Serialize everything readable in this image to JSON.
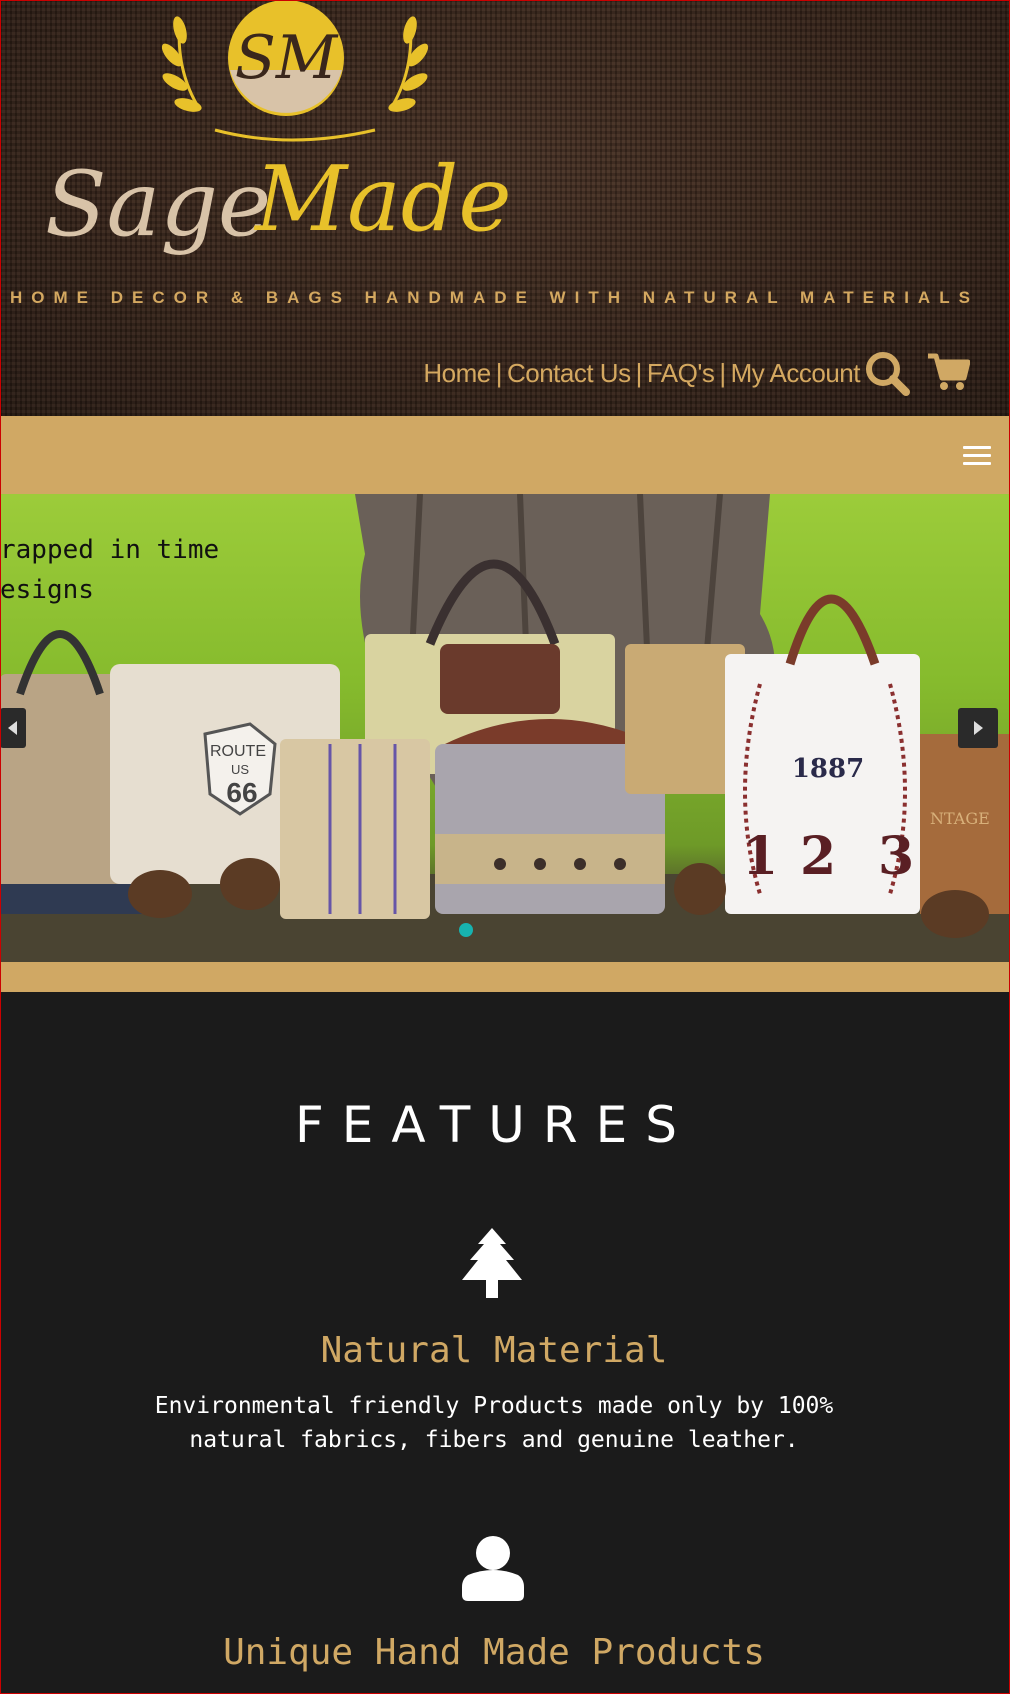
{
  "brand": {
    "logo_monogram": "SM",
    "logo_wordmark": "SageMade",
    "tagline": "HOME DECOR & BAGS HANDMADE WITH NATURAL MATERIALS"
  },
  "top_nav": {
    "items": [
      {
        "label": "Home"
      },
      {
        "label": "Contact Us"
      },
      {
        "label": "FAQ's"
      },
      {
        "label": "My Account"
      }
    ],
    "separator": "|",
    "icons": [
      "search-icon",
      "cart-icon"
    ]
  },
  "menu": {
    "icon": "hamburger-icon"
  },
  "slider": {
    "caption_line1": "rapped in time",
    "caption_line2": "esigns",
    "image_labels": {
      "route": "ROUTE",
      "us": "US",
      "route_number": "66",
      "year": "1887",
      "numbers": [
        "1",
        "2",
        "3"
      ],
      "vintage": "NTAGE"
    },
    "active_slide": 1
  },
  "features": {
    "heading": "FEATURES",
    "items": [
      {
        "icon": "tree-icon",
        "title": "Natural Material",
        "desc_line1": "Environmental friendly Products made only by 100%",
        "desc_line2": "natural fabrics, fibers and genuine leather."
      },
      {
        "icon": "user-icon",
        "title": "Unique Hand Made Products"
      }
    ]
  },
  "colors": {
    "gold": "#d0a864",
    "dark_bg": "#1b1b1b",
    "header_brown": "#3a271c",
    "accent_teal": "#17b3b0",
    "logo_yellow": "#e8c12a"
  }
}
